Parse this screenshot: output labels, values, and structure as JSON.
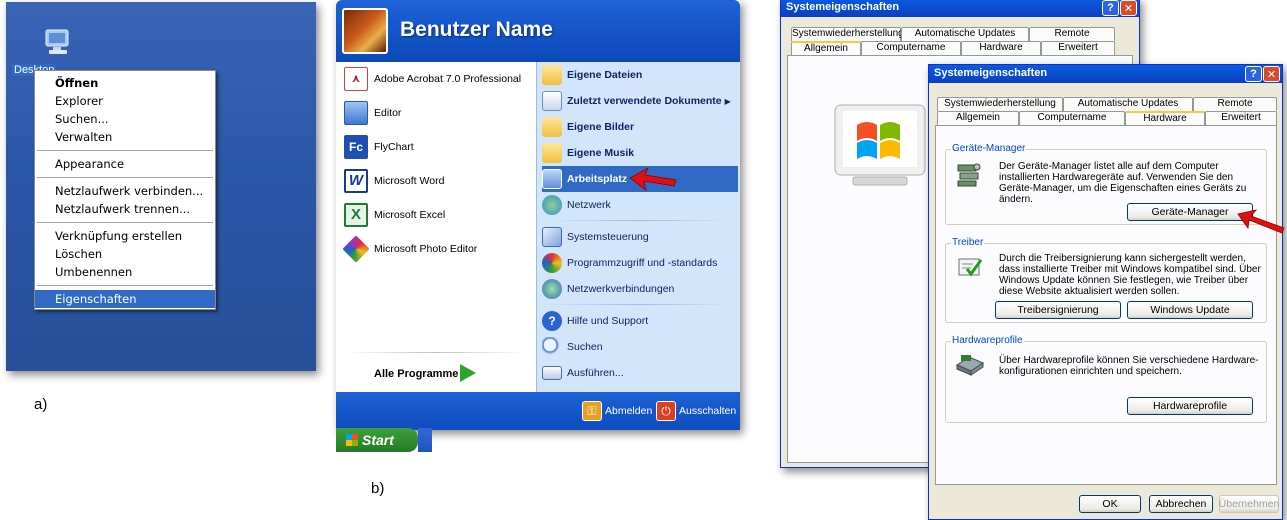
{
  "panel_a": {
    "desktop_label": "Desktop",
    "context_menu": {
      "items": [
        "Öffnen",
        "Explorer",
        "Suchen...",
        "Verwalten",
        "Appearance",
        "Netzlaufwerk verbinden...",
        "Netzlaufwerk trennen...",
        "Verknüpfung erstellen",
        "Löschen",
        "Umbenennen",
        "Eigenschaften"
      ]
    },
    "caption": "a)"
  },
  "panel_b": {
    "user_name": "Benutzer Name",
    "programs": [
      "Adobe Acrobat 7.0 Professional",
      "Editor",
      "FlyChart",
      "Microsoft Word",
      "Microsoft Excel",
      "Microsoft Photo Editor"
    ],
    "all_programs": "Alle Programme",
    "places": [
      "Eigene Dateien",
      "Zuletzt verwendete Dokumente",
      "Eigene Bilder",
      "Eigene Musik",
      "Arbeitsplatz",
      "Netzwerk",
      "Systemsteuerung",
      "Programmzugriff und -standards",
      "Netzwerkverbindungen",
      "Hilfe und Support",
      "Suchen",
      "Ausführen..."
    ],
    "logoff": "Abmelden",
    "shutdown": "Ausschalten",
    "start": "Start",
    "caption": "b)"
  },
  "window_back": {
    "title": "Systemeigenschaften",
    "tabs_top": [
      "Systemwiederherstellung",
      "Automatische Updates",
      "Remote"
    ],
    "tabs_bottom": [
      "Allgemein",
      "Computername",
      "Hardware",
      "Erweitert"
    ]
  },
  "window_front": {
    "title": "Systemeigenschaften",
    "tabs_top": [
      "Systemwiederherstellung",
      "Automatische Updates",
      "Remote"
    ],
    "tabs_bottom": [
      "Allgemein",
      "Computername",
      "Hardware",
      "Erweitert"
    ],
    "geraete": {
      "title": "Geräte-Manager",
      "text": "Der Geräte-Manager listet alle auf dem Computer installierten Hardwaregeräte auf. Verwenden Sie den Geräte-Manager, um die Eigenschaften eines Geräts zu ändern.",
      "button": "Geräte-Manager"
    },
    "treiber": {
      "title": "Treiber",
      "text": "Durch die Treibersignierung kann sichergestellt werden, dass installierte Treiber mit Windows kompatibel sind. Über Windows Update können Sie festlegen, wie Treiber über diese Website aktualisiert werden sollen.",
      "button1": "Treibersignierung",
      "button2": "Windows Update"
    },
    "profile": {
      "title": "Hardwareprofile",
      "text": "Über Hardwareprofile können Sie verschiedene Hardware-konfigurationen einrichten und speichern.",
      "button": "Hardwareprofile"
    },
    "ok": "OK",
    "cancel": "Abbrechen",
    "apply": "Übernehmen"
  },
  "colors": {
    "xp_blue": "#0a4ed0",
    "selection": "#316ac5",
    "arrow_red": "#e01010"
  }
}
